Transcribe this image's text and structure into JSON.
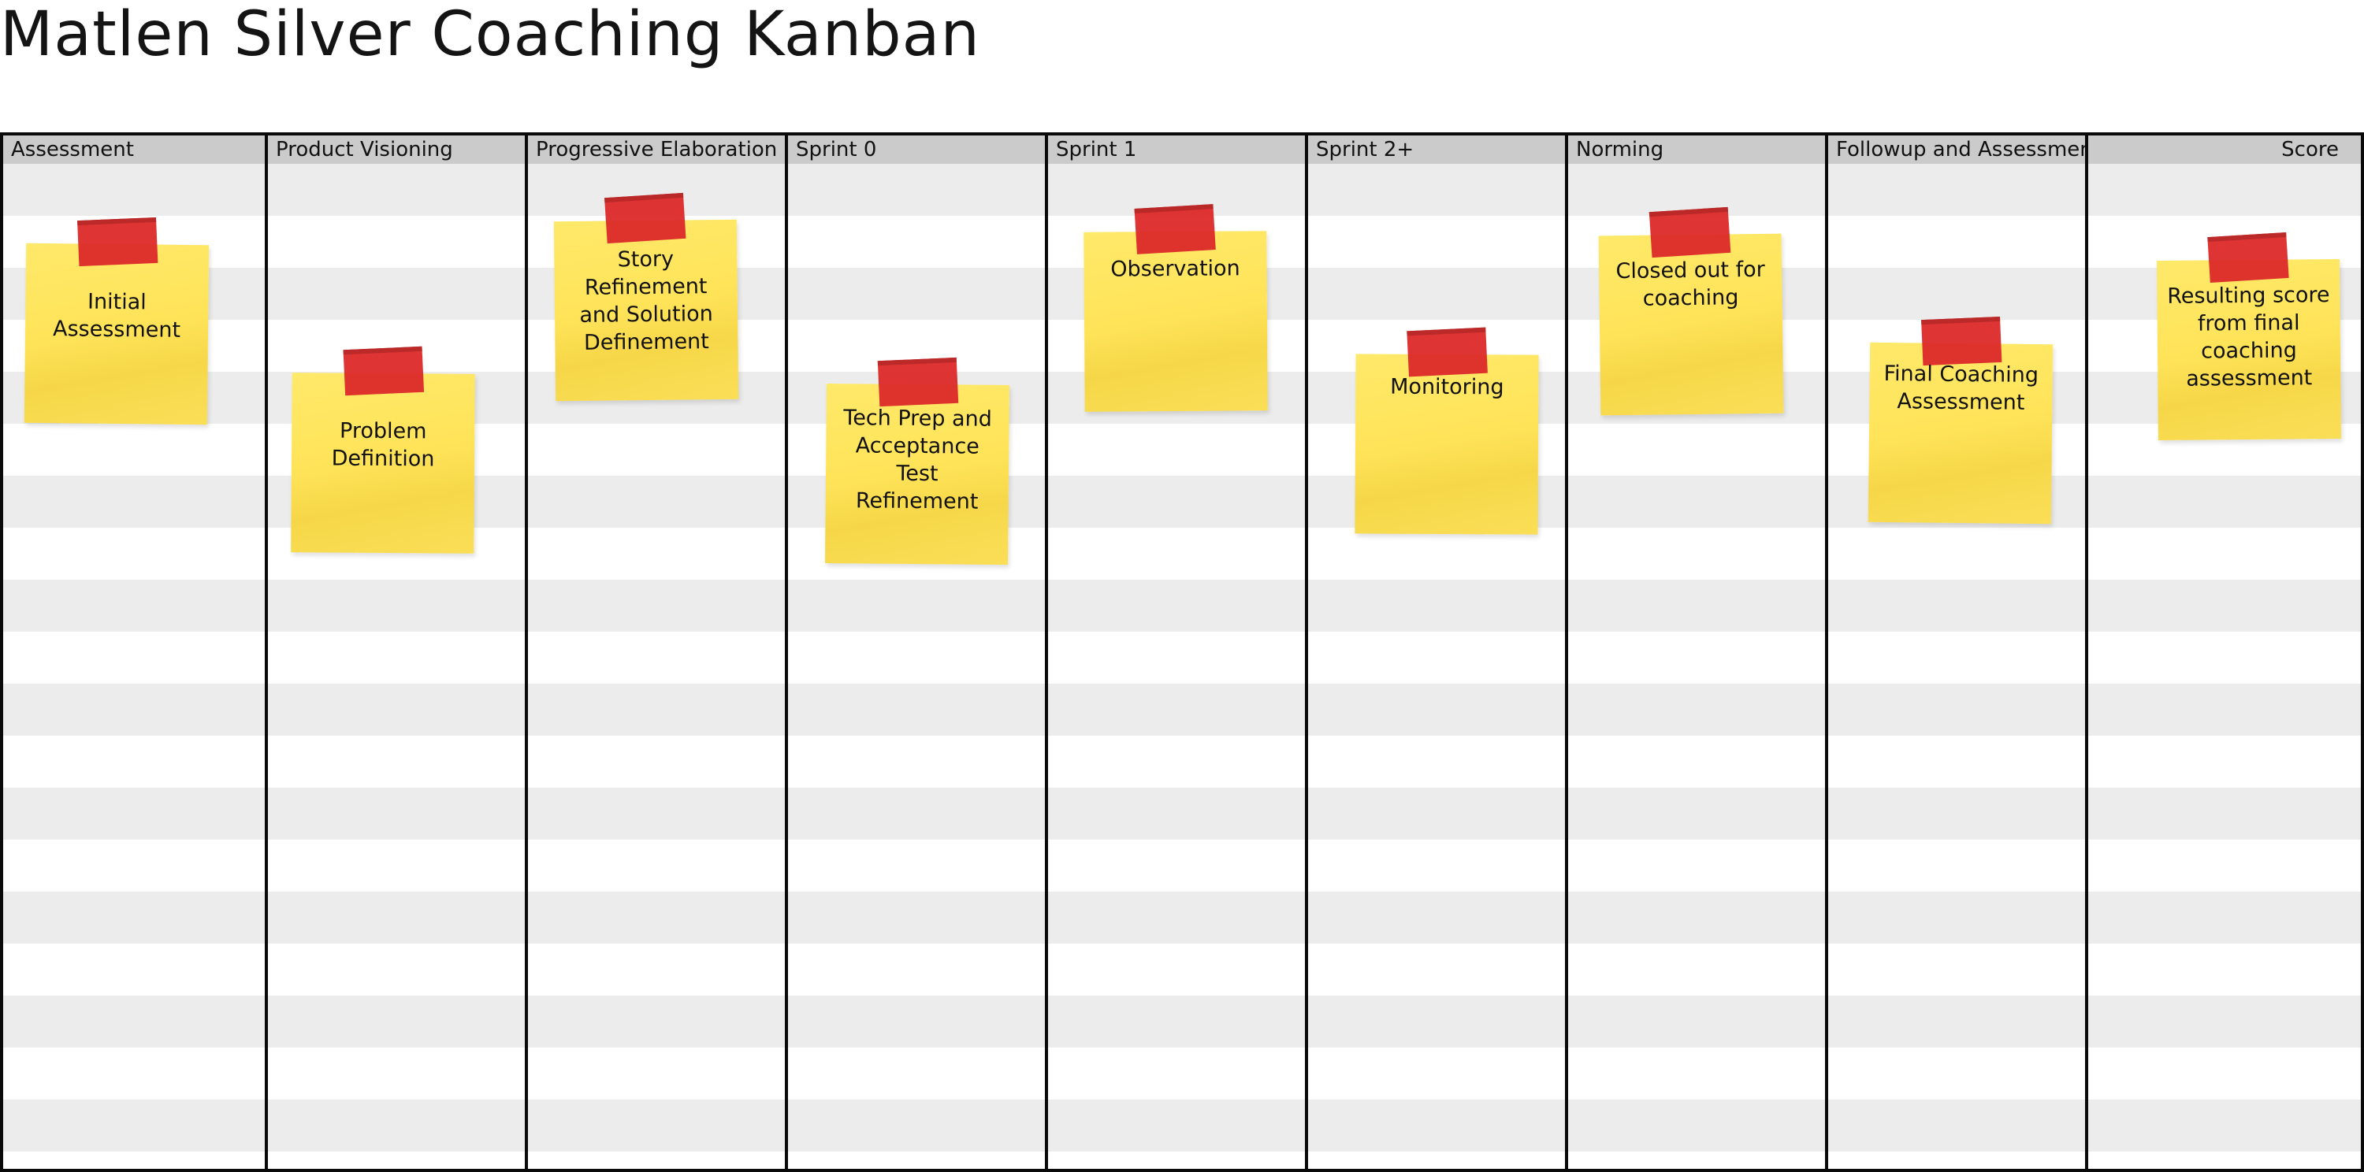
{
  "title": "Matlen Silver Coaching Kanban",
  "columns": [
    {
      "label": "Assessment"
    },
    {
      "label": "Product Visioning"
    },
    {
      "label": "Progressive Elaboration"
    },
    {
      "label": "Sprint 0"
    },
    {
      "label": "Sprint 1"
    },
    {
      "label": "Sprint 2+"
    },
    {
      "label": "Norming"
    },
    {
      "label": "Followup and Assessment"
    },
    {
      "label": "Score"
    }
  ],
  "notes": [
    {
      "text": "Initial Assessment"
    },
    {
      "text": "Problem Definition"
    },
    {
      "text": "Story Refinement and Solution Definement"
    },
    {
      "text": "Tech Prep and Acceptance Test Refinement"
    },
    {
      "text": "Observation"
    },
    {
      "text": "Monitoring"
    },
    {
      "text": "Closed out for coaching"
    },
    {
      "text": "Final Coaching Assessment"
    },
    {
      "text": "Resulting score from final coaching assessment"
    }
  ],
  "colors": {
    "note": "#ffe45a",
    "tape": "#dd2a2a",
    "header": "#cbcbcb",
    "stripe": "#ececec",
    "border": "#0a0a0a"
  }
}
